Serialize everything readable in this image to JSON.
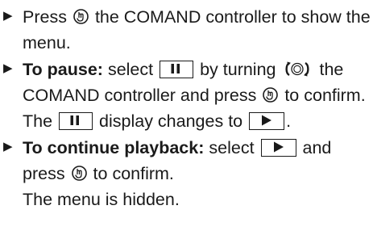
{
  "steps": [
    {
      "part1": "Press",
      "part2": "the COMAND controller to show the menu."
    },
    {
      "label": "To pause:",
      "part1": "select",
      "part2": "by turning",
      "part3": "the COMAND controller and press",
      "part4": "to confirm.",
      "result1": "The",
      "result2": "display changes to",
      "result3": "."
    },
    {
      "label": "To continue playback:",
      "part1": "select",
      "part2": "and press",
      "part3": "to confirm.",
      "result": "The menu is hidden."
    }
  ],
  "icons": {
    "bullet": "triangle-right-icon",
    "press": "press-controller-icon",
    "turn": "turn-controller-icon",
    "pause": "pause-icon",
    "play": "play-icon"
  }
}
